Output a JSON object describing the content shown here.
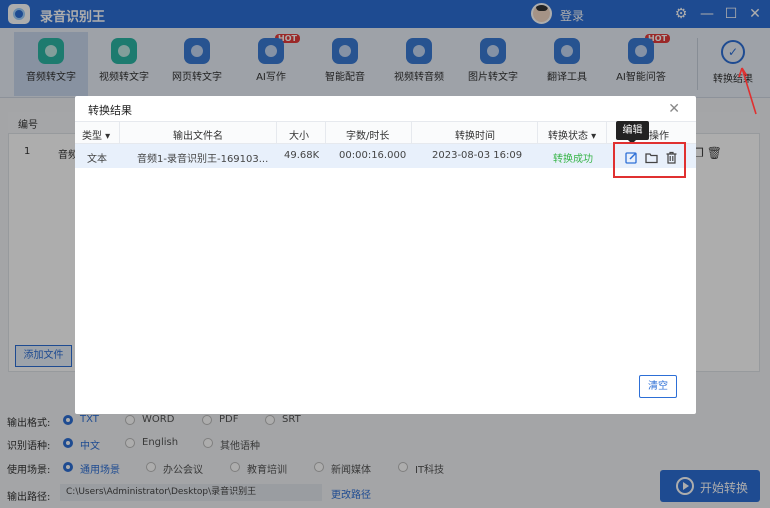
{
  "app": {
    "title": "录音识别王",
    "login": "登录"
  },
  "toolbar": {
    "items": [
      {
        "label": "音频转文字",
        "color": "#2cb5a4"
      },
      {
        "label": "视频转文字",
        "color": "#2cb5a4"
      },
      {
        "label": "网页转文字",
        "color": "#3a7bd5"
      },
      {
        "label": "AI写作",
        "color": "#3a7bd5",
        "hot": "HOT"
      },
      {
        "label": "智能配音",
        "color": "#3a7bd5"
      },
      {
        "label": "视频转音频",
        "color": "#3a7bd5"
      },
      {
        "label": "图片转文字",
        "color": "#3a7bd5"
      },
      {
        "label": "翻译工具",
        "color": "#3a7bd5"
      },
      {
        "label": "AI智能问答",
        "color": "#3a7bd5",
        "hot": "HOT"
      }
    ],
    "result_label": "转换结果"
  },
  "background": {
    "header_no": "编号",
    "row_no": "1",
    "row_name": "音频",
    "add_file": "添加文件"
  },
  "options": {
    "format": {
      "label": "输出格式:",
      "choices": [
        "TXT",
        "WORD",
        "PDF",
        "SRT"
      ],
      "selected": "TXT"
    },
    "language": {
      "label": "识别语种:",
      "choices": [
        "中文",
        "English",
        "其他语种"
      ],
      "selected": "中文"
    },
    "scene": {
      "label": "使用场景:",
      "choices": [
        "通用场景",
        "办公会议",
        "教育培训",
        "新闻媒体",
        "IT科技"
      ],
      "selected": "通用场景"
    },
    "path": {
      "label": "输出路径:",
      "value": "C:\\Users\\Administrator\\Desktop\\录音识别王",
      "change": "更改路径"
    }
  },
  "start_button": "开始转换",
  "dialog": {
    "title": "转换结果",
    "columns": {
      "type": "类型",
      "filename": "输出文件名",
      "size": "大小",
      "duration": "字数/时长",
      "time": "转换时间",
      "status": "转换状态",
      "ops": "操作"
    },
    "row": {
      "type": "文本",
      "filename": "音频1-录音识别王-169103...",
      "size": "49.68K",
      "duration": "00:00:16.000",
      "time": "2023-08-03 16:09",
      "status": "转换成功"
    },
    "tooltip": "编辑",
    "clear": "清空"
  },
  "accent_color": "#2d6fd6",
  "success_color": "#39b54a",
  "highlight_color": "#e03030"
}
